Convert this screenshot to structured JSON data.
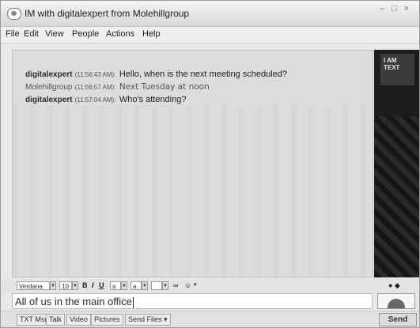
{
  "window": {
    "title": "IM with digitalexpert from Molehillgroup",
    "controls": "– □ ×"
  },
  "menu": [
    "File",
    "Edit",
    "View",
    "People",
    "Actions",
    "Help"
  ],
  "conversation": [
    {
      "sender": "digitalexpert",
      "time": "(11:56:43 AM):",
      "text": "Hello, when is the next meeting scheduled?"
    },
    {
      "sender": "Molehillgroup",
      "time": "(11:56:57 AM):",
      "text": "Next Tuesday at noon"
    },
    {
      "sender": "digitalexpert",
      "time": "(11:57:04 AM):",
      "text": "Who's attending?"
    }
  ],
  "sidepanel": {
    "ad_text": "I AM TEXT"
  },
  "format_toolbar": {
    "font": "Verdana",
    "size": "10",
    "bold": "B",
    "italic": "I",
    "underline": "U",
    "text_size": "a",
    "bg_color": "a",
    "link": "∞",
    "smiley": "☺",
    "right_icons": "● ◆"
  },
  "input": {
    "value": "All of us in the main office"
  },
  "bottom_tabs": [
    "TXT Msg",
    "Talk",
    "Video",
    "Pictures",
    "Send Files ▾"
  ],
  "send_label": "Send"
}
